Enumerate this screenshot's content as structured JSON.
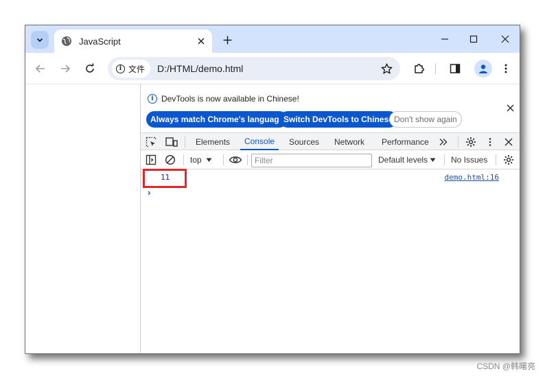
{
  "browser": {
    "tab_title": "JavaScript",
    "url_chip_label": "文件",
    "url": "D:/HTML/demo.html"
  },
  "devtools": {
    "infobar": {
      "message": "DevTools is now available in Chinese!",
      "btn_match": "Always match Chrome's language",
      "btn_switch": "Switch DevTools to Chinese",
      "btn_dismiss": "Don't show again"
    },
    "tabs": [
      {
        "label": "Elements"
      },
      {
        "label": "Console"
      },
      {
        "label": "Sources"
      },
      {
        "label": "Network"
      },
      {
        "label": "Performance"
      }
    ],
    "console_toolbar": {
      "context": "top",
      "filter_placeholder": "Filter",
      "levels": "Default levels",
      "issues": "No Issues"
    },
    "console": {
      "entries": [
        {
          "value": "11",
          "source": "demo.html:16"
        }
      ]
    }
  },
  "colors": {
    "accent": "#0b57d0",
    "tabstrip": "#d3e3fd",
    "highlight": "#e3262a"
  },
  "watermark": "CSDN @韩曙亮"
}
